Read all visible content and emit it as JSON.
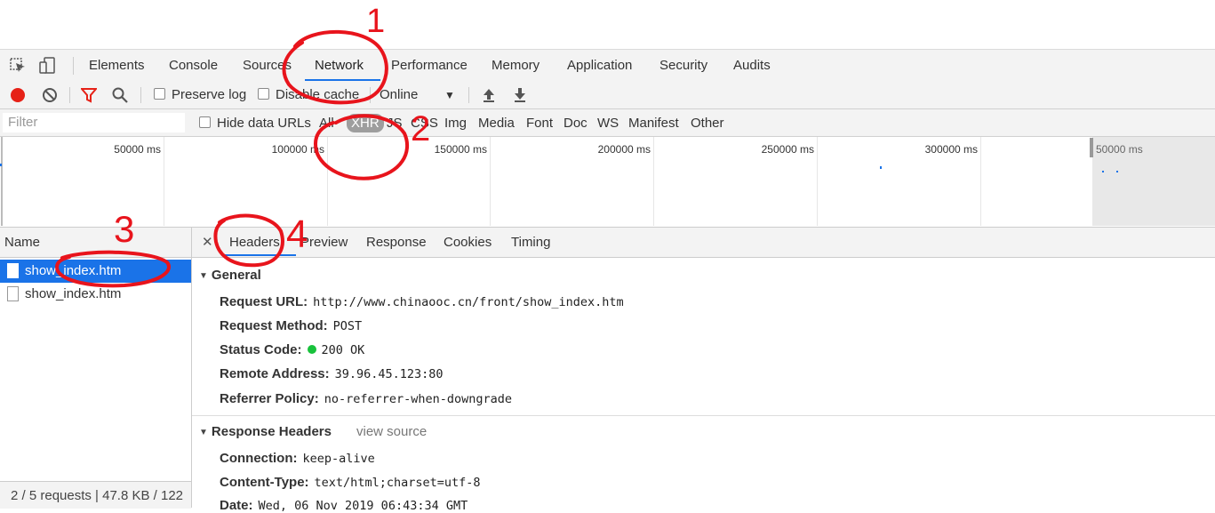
{
  "main_tabs": [
    "Elements",
    "Console",
    "Sources",
    "Network",
    "Performance",
    "Memory",
    "Application",
    "Security",
    "Audits"
  ],
  "toolbar": {
    "preserve_log": "Preserve log",
    "disable_cache": "Disable cache",
    "throttle": "Online"
  },
  "filter": {
    "placeholder": "Filter",
    "hide_data_urls": "Hide data URLs",
    "types": [
      "All",
      "XHR",
      "JS",
      "CSS",
      "Img",
      "Media",
      "Font",
      "Doc",
      "WS",
      "Manifest",
      "Other"
    ],
    "selected": "XHR"
  },
  "timeline": {
    "ticks": [
      "50000 ms",
      "100000 ms",
      "150000 ms",
      "200000 ms",
      "250000 ms",
      "300000 ms"
    ],
    "overview_label": "50000 ms"
  },
  "requests": {
    "header": "Name",
    "rows": [
      "show_index.htm",
      "show_index.htm"
    ],
    "status": "2 / 5 requests  |  47.8 KB / 122"
  },
  "detail_tabs": [
    "Headers",
    "Preview",
    "Response",
    "Cookies",
    "Timing"
  ],
  "general": {
    "title": "General",
    "request_url_label": "Request URL:",
    "request_url": "http://www.chinaooc.cn/front/show_index.htm",
    "method_label": "Request Method:",
    "method": "POST",
    "status_label": "Status Code:",
    "status": "200 OK",
    "remote_label": "Remote Address:",
    "remote": "39.96.45.123:80",
    "referrer_label": "Referrer Policy:",
    "referrer": "no-referrer-when-downgrade"
  },
  "response_headers": {
    "title": "Response Headers",
    "view_source": "view source",
    "connection_label": "Connection:",
    "connection": "keep-alive",
    "content_type_label": "Content-Type:",
    "content_type": "text/html;charset=utf-8",
    "date_label": "Date:",
    "date": "Wed, 06 Nov 2019 06:43:34 GMT"
  },
  "annotations": [
    "1",
    "2",
    "3",
    "4"
  ],
  "colors": {
    "accent": "#1a73e8",
    "record": "#e62117",
    "annotation": "#e8141c",
    "status_ok": "#18c23c"
  }
}
